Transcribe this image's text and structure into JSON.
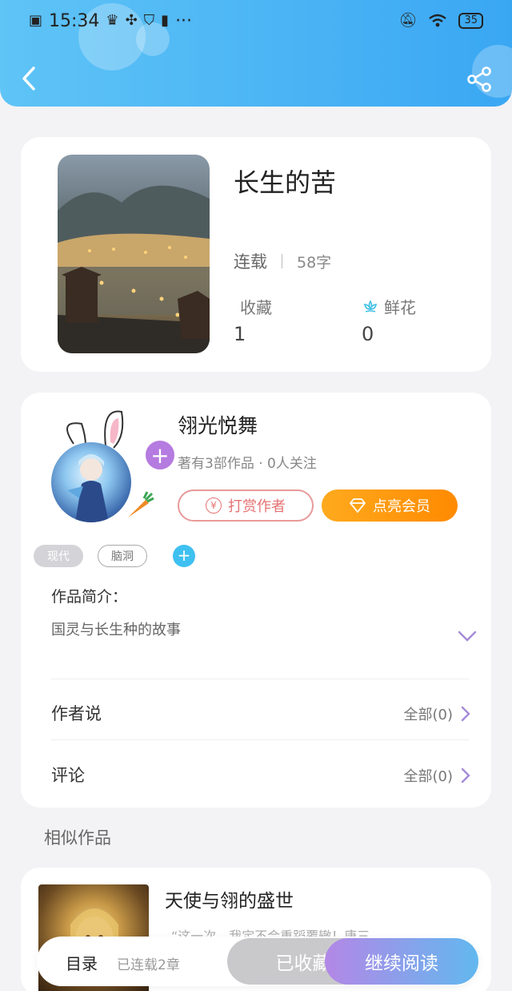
{
  "status_bar": {
    "time": "15:34",
    "dots": "···",
    "battery": "35"
  },
  "nav": {
    "back_icon": "chevron-left-icon",
    "share_icon": "share-icon"
  },
  "book": {
    "title": "长生的苦",
    "status": "连载",
    "word_count": "58字",
    "favorites_label": "收藏",
    "favorites_value": "1",
    "flowers_label": "鲜花",
    "flowers_value": "0"
  },
  "author": {
    "name": "翎光悦舞",
    "meta": "著有3部作品 · 0人关注",
    "tip_label": "打赏作者",
    "vip_label": "点亮会员",
    "tags": [
      "现代",
      "脑洞"
    ]
  },
  "intro": {
    "title": "作品简介：",
    "text": "国灵与长生种的故事"
  },
  "rows": {
    "author_says_label": "作者说",
    "author_says_count": "全部(0)",
    "comments_label": "评论",
    "comments_count": "全部(0)"
  },
  "similar": {
    "section_title": "相似作品",
    "items": [
      {
        "title": "天使与翎的盛世",
        "desc": "“这一次，我定不会重蹈覆辙！唐三..."
      }
    ]
  },
  "bottom_bar": {
    "toc_label": "目录",
    "toc_meta": "已连载2章",
    "collected_label": "已收藏",
    "read_label": "继续阅读"
  },
  "colors": {
    "header_start": "#5fc4f6",
    "header_end": "#3aa7f3",
    "accent_purple": "#b57be0",
    "vip_orange": "#ff8a00",
    "tip_red": "#e57373"
  }
}
